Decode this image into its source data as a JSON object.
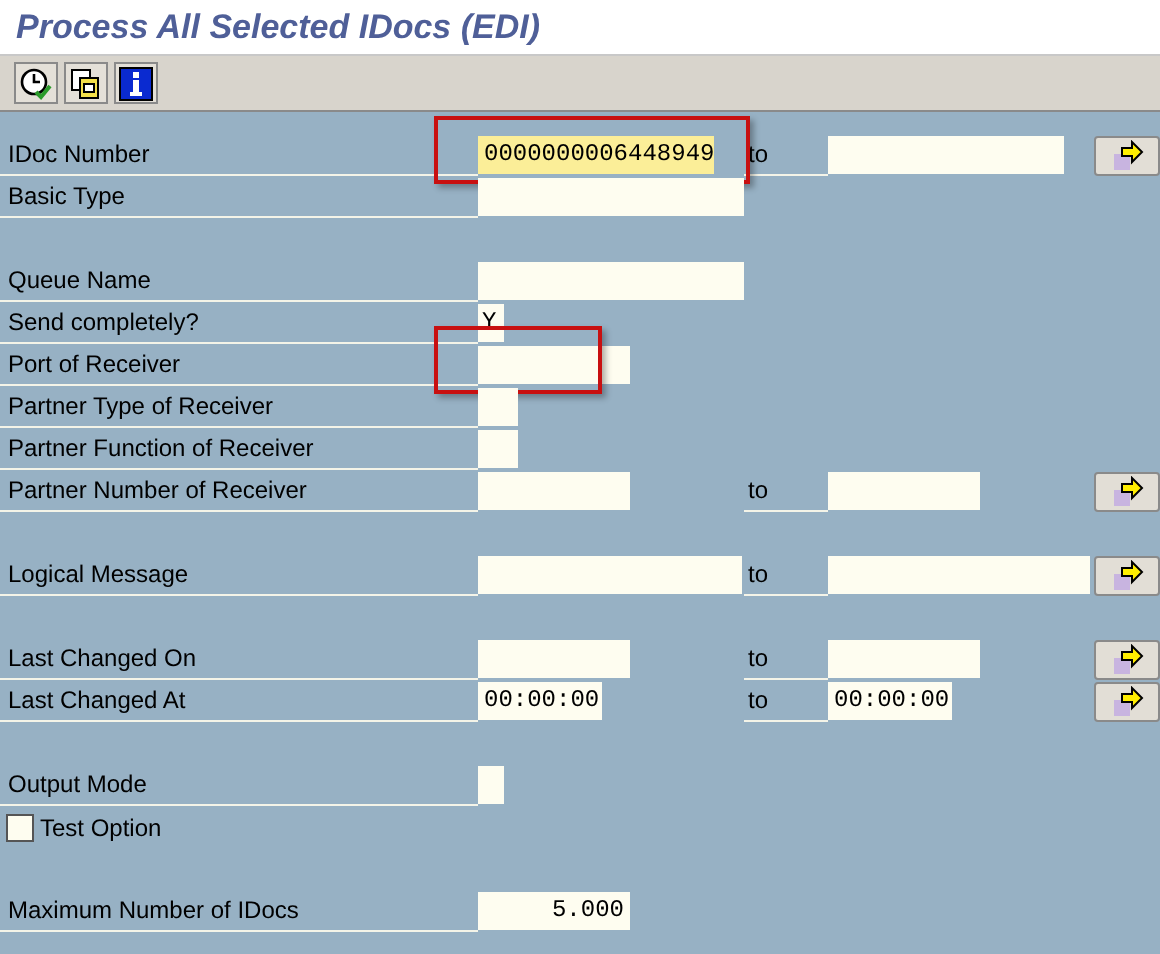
{
  "window": {
    "title": "Process All Selected IDocs (EDI)"
  },
  "toolbar": [
    {
      "kind": "execute"
    },
    {
      "kind": "variant"
    },
    {
      "kind": "info"
    }
  ],
  "rows": [
    {
      "kind": "field",
      "label": "IDoc Number",
      "value": "0000000006448949",
      "highlight": true,
      "to": {
        "label": "to"
      },
      "more": true
    },
    {
      "kind": "field",
      "label": "Basic Type"
    },
    {
      "kind": "blank"
    },
    {
      "kind": "field",
      "label": "Queue Name"
    },
    {
      "kind": "field",
      "label": "Send completely?",
      "value": "Y"
    },
    {
      "kind": "field",
      "label": "Port of Receiver",
      "highlight": true
    },
    {
      "kind": "field",
      "label": "Partner Type of Receiver"
    },
    {
      "kind": "field",
      "label": "Partner Function of Receiver"
    },
    {
      "kind": "field",
      "label": "Partner Number of Receiver",
      "to": {
        "label": "to"
      },
      "more": true
    },
    {
      "kind": "blank"
    },
    {
      "kind": "field",
      "label": "Logical Message",
      "to": {
        "label": "to"
      },
      "more": true
    },
    {
      "kind": "blank"
    },
    {
      "kind": "field",
      "label": "Last Changed On",
      "to": {
        "label": "to"
      },
      "more": true
    },
    {
      "kind": "field",
      "label": "Last Changed At",
      "value": "00:00:00",
      "to": {
        "label": "to",
        "value": "00:00:00"
      },
      "more": true
    },
    {
      "kind": "blank"
    },
    {
      "kind": "field",
      "label": "Output Mode"
    },
    {
      "kind": "checkbox",
      "label": "Test Option",
      "checked": false
    },
    {
      "kind": "blank"
    },
    {
      "kind": "field",
      "label": "Maximum Number of IDocs",
      "value": "5.000"
    }
  ]
}
